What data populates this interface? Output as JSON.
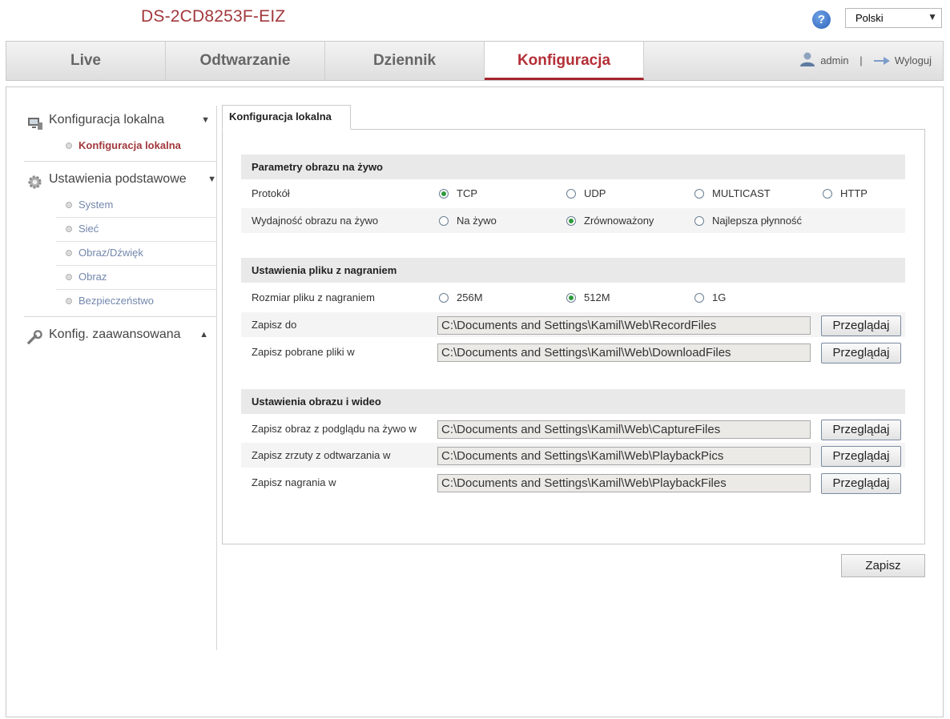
{
  "header": {
    "product_name": "DS-2CD8253F-EIZ",
    "help_icon": "question-mark",
    "language": "Polski"
  },
  "nav": {
    "tabs": [
      {
        "label": "Live"
      },
      {
        "label": "Odtwarzanie"
      },
      {
        "label": "Dziennik"
      },
      {
        "label": "Konfiguracja",
        "active": true
      }
    ],
    "user": "admin",
    "separator": "|",
    "logout": "Wyloguj"
  },
  "sidebar": {
    "local": {
      "label": "Konfiguracja lokalna",
      "icon": "monitor-icon",
      "chevron": "⌄"
    },
    "local_items": [
      {
        "label": "Konfiguracja lokalna",
        "active": true
      }
    ],
    "basic": {
      "label": "Ustawienia podstawowe",
      "icon": "gear-icon",
      "chevron": "⌄"
    },
    "basic_items": [
      {
        "label": "System"
      },
      {
        "label": "Sieć"
      },
      {
        "label": "Obraz/Dźwięk"
      },
      {
        "label": "Obraz"
      },
      {
        "label": "Bezpieczeństwo"
      }
    ],
    "advanced": {
      "label": "Konfig. zaawansowana",
      "icon": "wrench-icon",
      "chevron": "⌃"
    }
  },
  "content": {
    "tab_label": "Konfiguracja lokalna",
    "live_section": {
      "title": "Parametry obrazu na żywo",
      "protocol_label": "Protokół",
      "protocol_options": [
        "TCP",
        "UDP",
        "MULTICAST",
        "HTTP"
      ],
      "protocol_selected": "TCP",
      "performance_label": "Wydajność obrazu na żywo",
      "performance_options": [
        "Na żywo",
        "Zrównoważony",
        "Najlepsza płynność"
      ],
      "performance_selected": "Zrównoważony"
    },
    "record_section": {
      "title": "Ustawienia pliku z nagraniem",
      "size_label": "Rozmiar pliku z nagraniem",
      "size_options": [
        "256M",
        "512M",
        "1G"
      ],
      "size_selected": "512M",
      "save_to_label": "Zapisz do",
      "save_to_path": "C:\\Documents and Settings\\Kamil\\Web\\RecordFiles",
      "download_label": "Zapisz pobrane pliki w",
      "download_path": "C:\\Documents and Settings\\Kamil\\Web\\DownloadFiles"
    },
    "media_section": {
      "title": "Ustawienia obrazu i wideo",
      "capture_label": "Zapisz obraz z podglądu na żywo w",
      "capture_path": "C:\\Documents and Settings\\Kamil\\Web\\CaptureFiles",
      "playback_pics_label": "Zapisz zrzuty z odtwarzania w",
      "playback_pics_path": "C:\\Documents and Settings\\Kamil\\Web\\PlaybackPics",
      "playback_files_label": "Zapisz nagrania w",
      "playback_files_path": "C:\\Documents and Settings\\Kamil\\Web\\PlaybackFiles"
    },
    "browse_label": "Przeglądaj",
    "save_label": "Zapisz"
  },
  "colors": {
    "brand_red": "#a2383c",
    "radio_selected": "#2e9b3b",
    "sidebar_link": "#7387ad"
  }
}
